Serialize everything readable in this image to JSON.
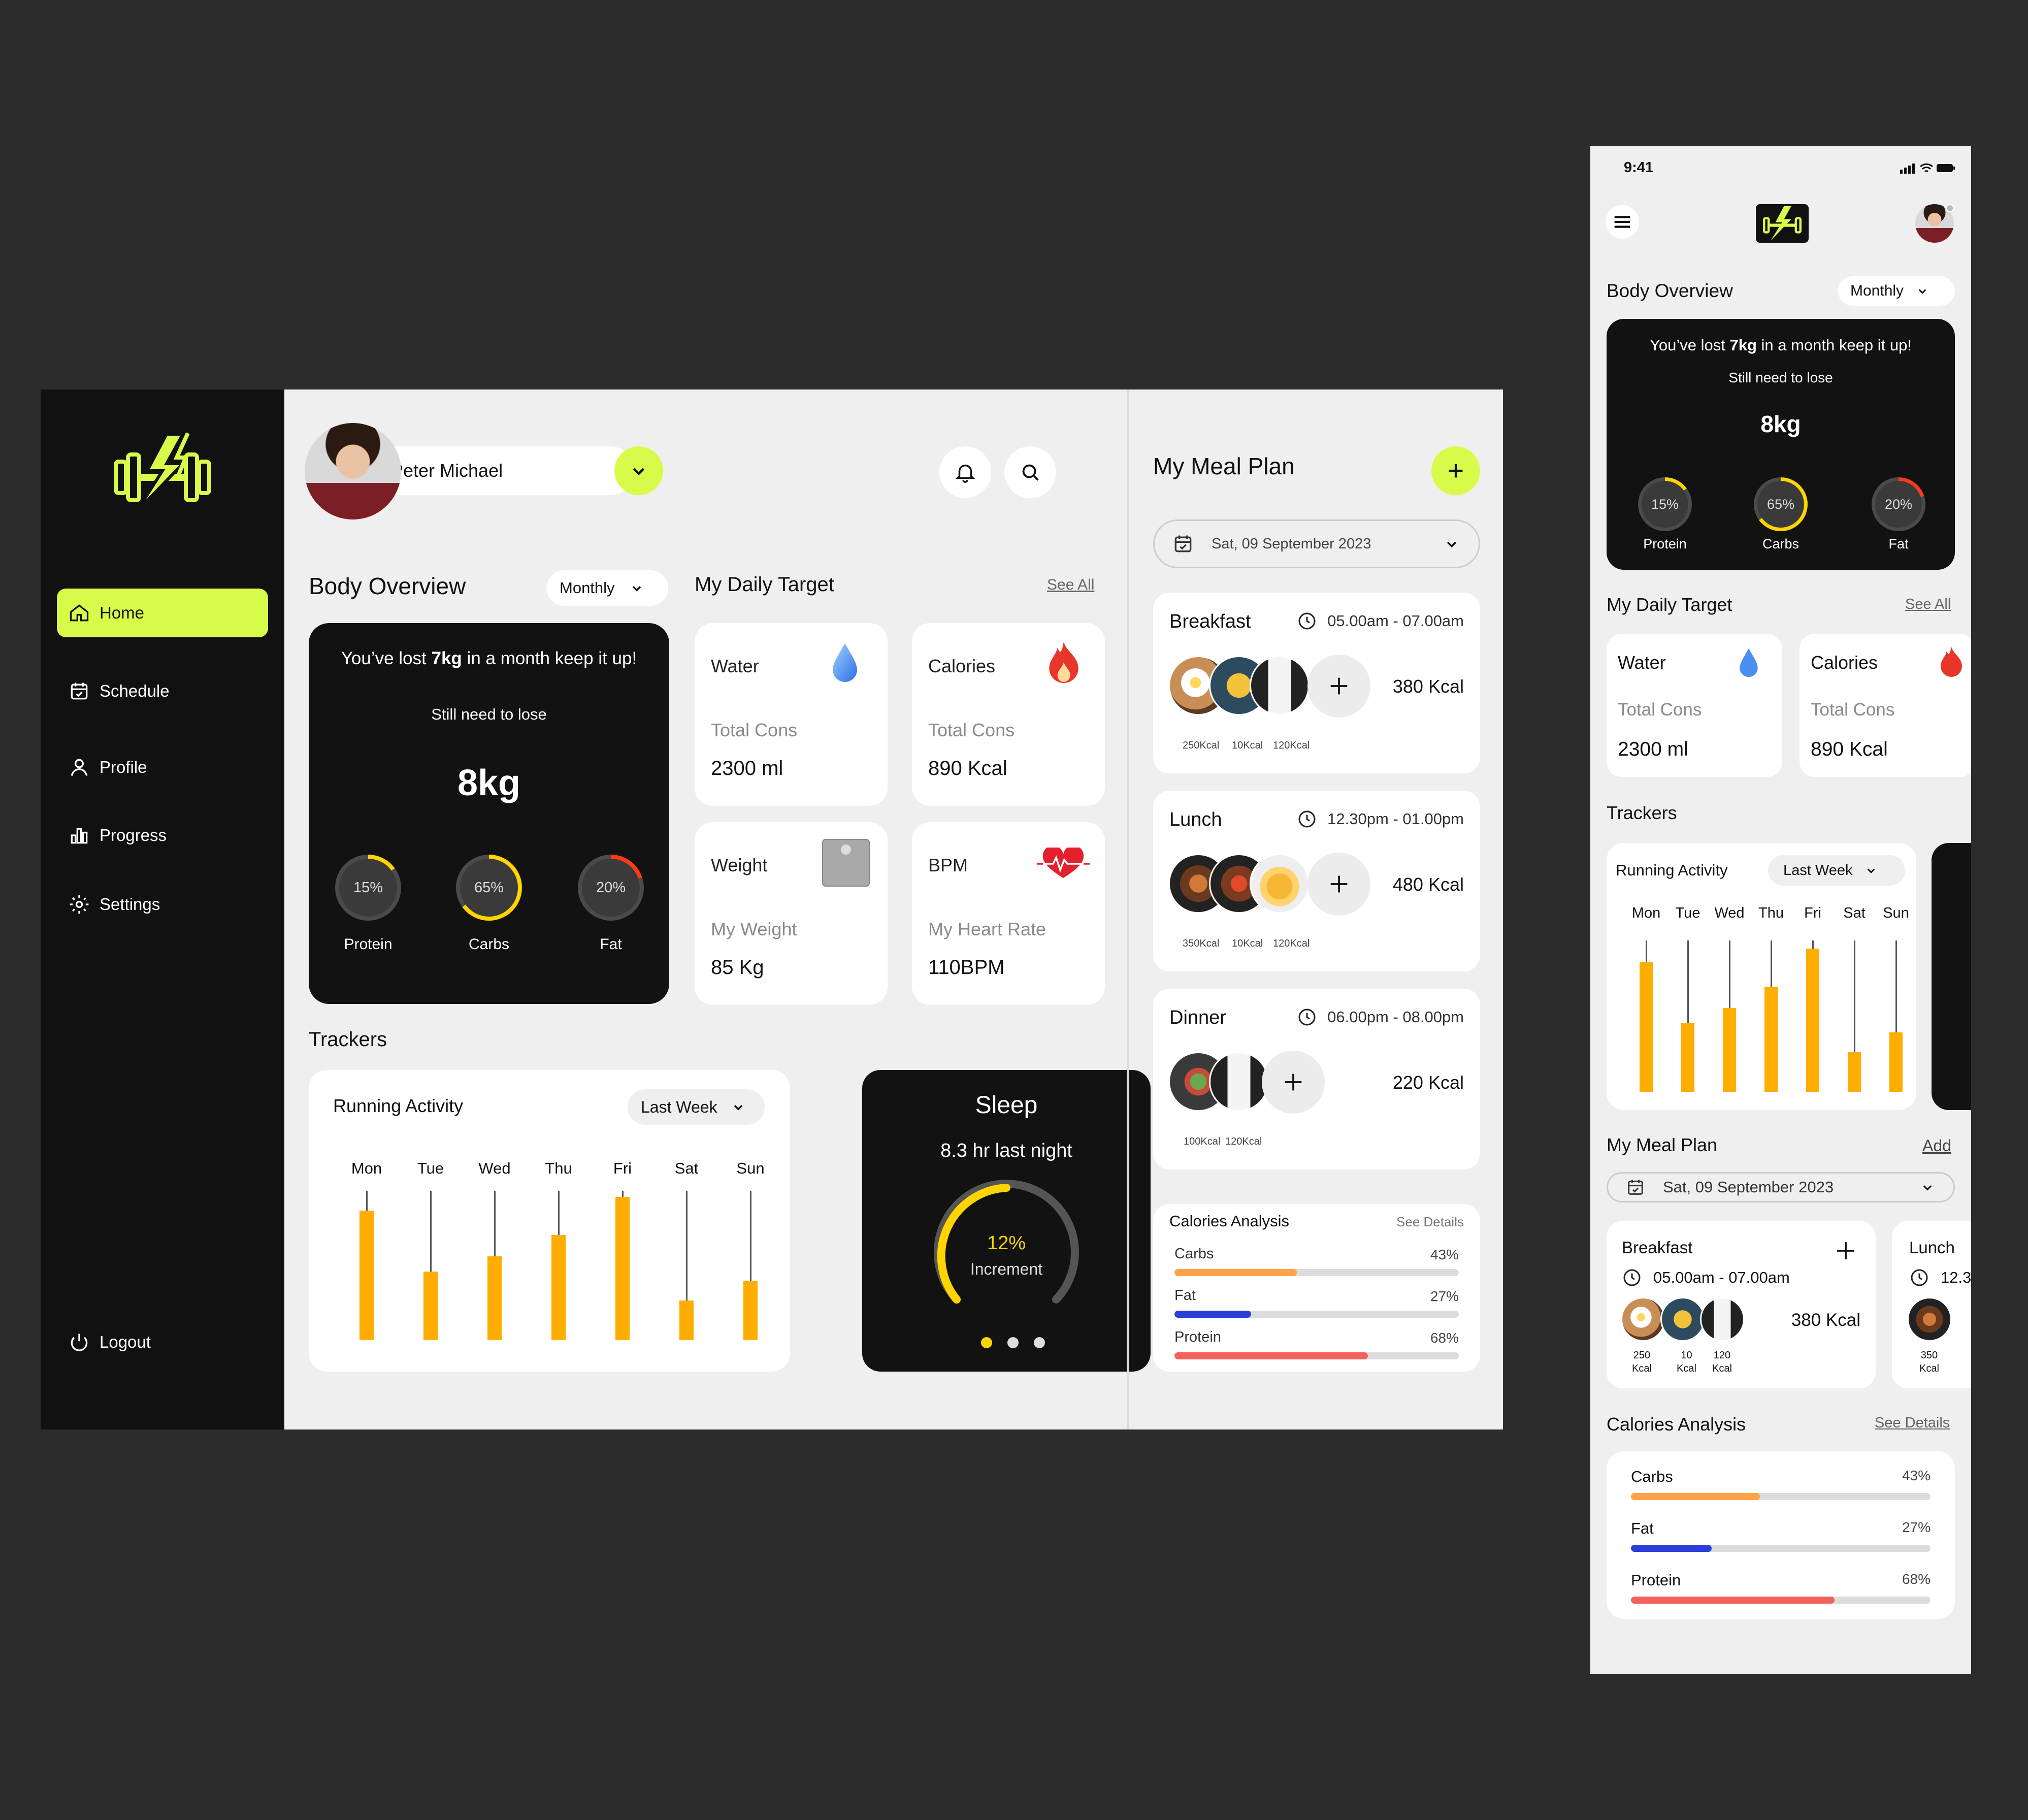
{
  "app": {
    "user_name": "Peter Michael"
  },
  "nav": {
    "items": [
      {
        "label": "Home",
        "icon": "home-icon"
      },
      {
        "label": "Schedule",
        "icon": "calendar-icon"
      },
      {
        "label": "Profile",
        "icon": "user-icon"
      },
      {
        "label": "Progress",
        "icon": "chart-icon"
      },
      {
        "label": "Settings",
        "icon": "gear-icon"
      }
    ],
    "logout": "Logout"
  },
  "body_overview": {
    "title": "Body Overview",
    "period": "Monthly",
    "message_pre": "You’ve lost ",
    "message_bold": "7kg",
    "message_post": " in a month keep it up!",
    "still": "Still need to lose",
    "amount": "8kg",
    "macros": [
      {
        "label": "Protein",
        "pct": "15%",
        "value": 15,
        "color": "#ffd400"
      },
      {
        "label": "Carbs",
        "pct": "65%",
        "value": 65,
        "color": "#ffd400"
      },
      {
        "label": "Fat",
        "pct": "20%",
        "value": 20,
        "color": "#ff3a1a"
      }
    ]
  },
  "daily_target": {
    "title": "My Daily Target",
    "see_all": "See All",
    "cards": [
      {
        "title": "Water",
        "sub": "Total Cons",
        "value": "2300 ml",
        "icon": "water-drop-icon"
      },
      {
        "title": "Calories",
        "sub": "Total Cons",
        "value": "890 Kcal",
        "icon": "flame-icon"
      },
      {
        "title": "Weight",
        "sub": "My Weight",
        "value": "85 Kg",
        "icon": "scale-icon"
      },
      {
        "title": "BPM",
        "sub": "My Heart Rate",
        "value": "110BPM",
        "icon": "heart-rate-icon"
      }
    ]
  },
  "trackers": {
    "title": "Trackers",
    "running": {
      "title": "Running Activity",
      "period": "Last Week"
    },
    "sleep": {
      "title": "Sleep",
      "subtitle": "8.3 hr last night",
      "pct": "12%",
      "label": "Increment"
    }
  },
  "chart_data": {
    "type": "bar",
    "categories": [
      "Mon",
      "Tue",
      "Wed",
      "Thu",
      "Fri",
      "Sat",
      "Sun"
    ],
    "values": [
      0.85,
      0.45,
      0.55,
      0.69,
      0.94,
      0.26,
      0.39
    ],
    "ylim": [
      0,
      1
    ]
  },
  "meal_plan": {
    "title": "My Meal Plan",
    "mobile_add": "Add",
    "date": "Sat, 09 September 2023",
    "meals": [
      {
        "name": "Breakfast",
        "time": "05.00am - 07.00am",
        "kcal": "380 Kcal",
        "items": [
          "250Kcal",
          "10Kcal",
          "120Kcal"
        ],
        "mobile_items": [
          "250",
          "10",
          "120"
        ]
      },
      {
        "name": "Lunch",
        "time": "12.30pm - 01.00pm",
        "kcal": "480 Kcal",
        "items": [
          "350Kcal",
          "10Kcal",
          "120Kcal"
        ],
        "mobile_time": "12.3",
        "mobile_items": [
          "350"
        ]
      },
      {
        "name": "Dinner",
        "time": "06.00pm - 08.00pm",
        "kcal": "220 Kcal",
        "items": [
          "100Kcal",
          "120Kcal"
        ]
      }
    ],
    "kcal_unit": "Kcal"
  },
  "calories_analysis": {
    "title": "Calories Analysis",
    "see_details": "See Details",
    "rows": [
      {
        "label": "Carbs",
        "pct": "43%",
        "value": 43,
        "color": "#ffa24a"
      },
      {
        "label": "Fat",
        "pct": "27%",
        "value": 27,
        "color": "#2b3fd8"
      },
      {
        "label": "Protein",
        "pct": "68%",
        "value": 68,
        "color": "#f0625a"
      }
    ]
  },
  "mobile": {
    "time": "9:41"
  }
}
